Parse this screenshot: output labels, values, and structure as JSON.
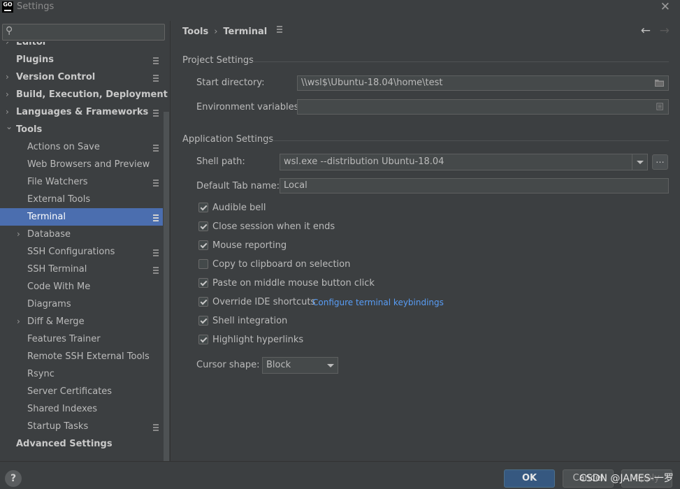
{
  "window": {
    "title": "Settings",
    "app_icon": "GO"
  },
  "search": {
    "placeholder": ""
  },
  "sidebar": {
    "items": [
      {
        "label": "Editor",
        "bold": true,
        "chevron": true
      },
      {
        "label": "Plugins",
        "bold": true,
        "page_icon": true
      },
      {
        "label": "Version Control",
        "bold": true,
        "chevron": true,
        "page_icon": true
      },
      {
        "label": "Build, Execution, Deployment",
        "bold": true,
        "chevron": true
      },
      {
        "label": "Languages & Frameworks",
        "bold": true,
        "chevron": true,
        "page_icon": true
      },
      {
        "label": "Tools",
        "bold": true,
        "chevron": true,
        "expanded": true
      },
      {
        "label": "Actions on Save",
        "page_icon": true
      },
      {
        "label": "Web Browsers and Preview"
      },
      {
        "label": "File Watchers",
        "page_icon": true
      },
      {
        "label": "External Tools"
      },
      {
        "label": "Terminal",
        "page_icon": true,
        "selected": true
      },
      {
        "label": "Database",
        "chevron": true
      },
      {
        "label": "SSH Configurations",
        "page_icon": true
      },
      {
        "label": "SSH Terminal",
        "page_icon": true
      },
      {
        "label": "Code With Me"
      },
      {
        "label": "Diagrams"
      },
      {
        "label": "Diff & Merge",
        "chevron": true
      },
      {
        "label": "Features Trainer"
      },
      {
        "label": "Remote SSH External Tools"
      },
      {
        "label": "Rsync"
      },
      {
        "label": "Server Certificates"
      },
      {
        "label": "Shared Indexes"
      },
      {
        "label": "Startup Tasks",
        "page_icon": true
      },
      {
        "label": "Advanced Settings",
        "bold": true
      }
    ]
  },
  "breadcrumb": {
    "parent": "Tools",
    "separator": "›",
    "current": "Terminal"
  },
  "project_settings": {
    "title": "Project Settings",
    "start_directory": {
      "label": "Start directory:",
      "value": "\\\\wsl$\\Ubuntu-18.04\\home\\test"
    },
    "environment_variables": {
      "label": "Environment variables:",
      "value": ""
    }
  },
  "application_settings": {
    "title": "Application Settings",
    "shell_path": {
      "label": "Shell path:",
      "value": "wsl.exe --distribution Ubuntu-18.04",
      "browse": "..."
    },
    "default_tab_name": {
      "label": "Default Tab name:",
      "value": "Local"
    },
    "checkboxes": [
      {
        "label": "Audible bell",
        "checked": true
      },
      {
        "label": "Close session when it ends",
        "checked": true
      },
      {
        "label": "Mouse reporting",
        "checked": true
      },
      {
        "label": "Copy to clipboard on selection",
        "checked": false
      },
      {
        "label": "Paste on middle mouse button click",
        "checked": true
      },
      {
        "label": "Override IDE shortcuts",
        "checked": true,
        "link": "Configure terminal keybindings"
      },
      {
        "label": "Shell integration",
        "checked": true
      },
      {
        "label": "Highlight hyperlinks",
        "checked": true
      }
    ],
    "cursor_shape": {
      "label": "Cursor shape:",
      "value": "Block"
    }
  },
  "footer": {
    "help": "?",
    "ok": "OK",
    "cancel": "Cancel",
    "apply": "Apply",
    "watermark": "CSDN @JAMES-一罗"
  },
  "colors": {
    "selection": "#4b6eaf",
    "link": "#589df6",
    "ok_button": "#365880",
    "background": "#3c3f41"
  }
}
